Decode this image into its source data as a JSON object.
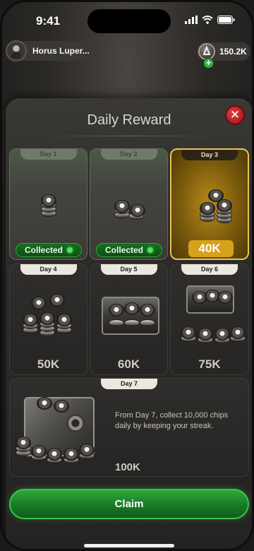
{
  "status_bar": {
    "time": "9:41"
  },
  "header": {
    "player_name": "Horus Luper...",
    "balance": "150.2K",
    "add_icon": "plus-icon",
    "coin_icon": "chip-icon"
  },
  "modal": {
    "title": "Daily Reward",
    "close_icon": "close-icon",
    "collected_label": "Collected",
    "days": [
      {
        "label": "Day 1",
        "amount": "",
        "status": "collected"
      },
      {
        "label": "Day 2",
        "amount": "",
        "status": "collected"
      },
      {
        "label": "Day 3",
        "amount": "40K",
        "status": "active"
      },
      {
        "label": "Day 4",
        "amount": "50K",
        "status": "locked"
      },
      {
        "label": "Day 5",
        "amount": "60K",
        "status": "locked"
      },
      {
        "label": "Day 6",
        "amount": "75K",
        "status": "locked"
      },
      {
        "label": "Day 7",
        "amount": "100K",
        "status": "locked"
      }
    ],
    "day7_description": "From Day 7, collect 10,000 chips daily by keeping your streak.",
    "claim_label": "Claim"
  },
  "colors": {
    "accent_green": "#2ea83b",
    "gold": "#d8a11c",
    "close_red": "#e33d3d"
  }
}
